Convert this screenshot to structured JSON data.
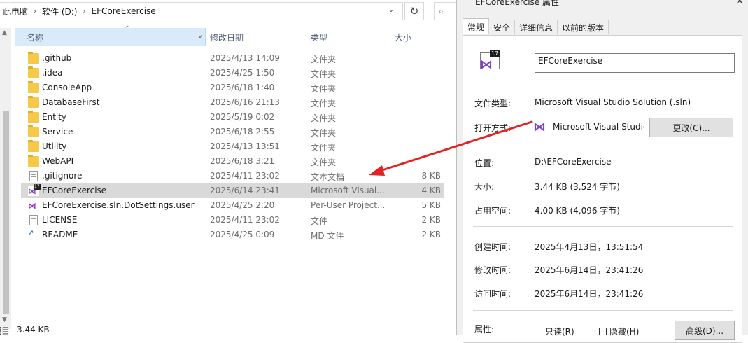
{
  "explorer": {
    "breadcrumb": [
      "此电脑",
      "软件 (D:)",
      "EFCoreExercise"
    ],
    "columns": {
      "name": "名称",
      "date": "修改日期",
      "type": "类型",
      "size": "大小"
    },
    "files": [
      {
        "icon": "folder-icon",
        "name": ".github",
        "date": "2025/4/13 14:09",
        "type": "文件夹",
        "size": ""
      },
      {
        "icon": "folder-icon",
        "name": ".idea",
        "date": "2025/4/25 1:50",
        "type": "文件夹",
        "size": ""
      },
      {
        "icon": "folder-icon",
        "name": "ConsoleApp",
        "date": "2025/6/18 1:40",
        "type": "文件夹",
        "size": ""
      },
      {
        "icon": "folder-icon",
        "name": "DatabaseFirst",
        "date": "2025/6/16 21:13",
        "type": "文件夹",
        "size": ""
      },
      {
        "icon": "folder-icon",
        "name": "Entity",
        "date": "2025/5/19 0:02",
        "type": "文件夹",
        "size": ""
      },
      {
        "icon": "folder-icon",
        "name": "Service",
        "date": "2025/6/18 2:55",
        "type": "文件夹",
        "size": ""
      },
      {
        "icon": "folder-icon",
        "name": "Utility",
        "date": "2025/4/13 13:51",
        "type": "文件夹",
        "size": ""
      },
      {
        "icon": "folder-icon",
        "name": "WebAPI",
        "date": "2025/6/18 3:21",
        "type": "文件夹",
        "size": ""
      },
      {
        "icon": "text-file-icon",
        "name": ".gitignore",
        "date": "2025/4/11 23:02",
        "type": "文本文档",
        "size": "8 KB"
      },
      {
        "icon": "visual-studio-solution-icon",
        "name": "EFCoreExercise",
        "date": "2025/6/14 23:41",
        "type": "Microsoft Visual...",
        "size": "4 KB",
        "selected": true
      },
      {
        "icon": "user-settings-file-icon",
        "name": "EFCoreExercise.sln.DotSettings.user",
        "date": "2025/4/25 2:20",
        "type": "Per-User Project...",
        "size": "5 KB"
      },
      {
        "icon": "file-icon",
        "name": "LICENSE",
        "date": "2025/4/11 23:02",
        "type": "文件",
        "size": "2 KB"
      },
      {
        "icon": "markdown-file-icon",
        "name": "README",
        "date": "2025/4/25 0:09",
        "type": "MD 文件",
        "size": "2 KB"
      }
    ],
    "status": {
      "left": "项目",
      "selected_size": "3.44 KB"
    }
  },
  "properties": {
    "title": "EFCoreExercise 属性",
    "tabs": [
      "常规",
      "安全",
      "详细信息",
      "以前的版本"
    ],
    "icon_badge": "17",
    "file_name": "EFCoreExercise",
    "file_type_label": "文件类型:",
    "file_type_value": "Microsoft Visual Studio Solution (.sln)",
    "open_with_label": "打开方式:",
    "open_with_value": "Microsoft Visual Studio",
    "change_button": "更改(C)...",
    "location_label": "位置:",
    "location_value": "D:\\EFCoreExercise",
    "size_label": "大小:",
    "size_value": "3.44 KB (3,524 字节)",
    "disk_size_label": "占用空间:",
    "disk_size_value": "4.00 KB (4,096 字节)",
    "created_label": "创建时间:",
    "created_value": "2025年4月13日，13:51:54",
    "modified_label": "修改时间:",
    "modified_value": "2025年6月14日，23:41:26",
    "accessed_label": "访问时间:",
    "accessed_value": "2025年6月14日，23:41:26",
    "attributes_label": "属性:",
    "readonly_label": "只读(R)",
    "hidden_label": "隐藏(H)",
    "advanced_button": "高级(D)...",
    "close_glyph": "✕"
  },
  "annotation": {
    "arrow_color": "#e02424"
  }
}
